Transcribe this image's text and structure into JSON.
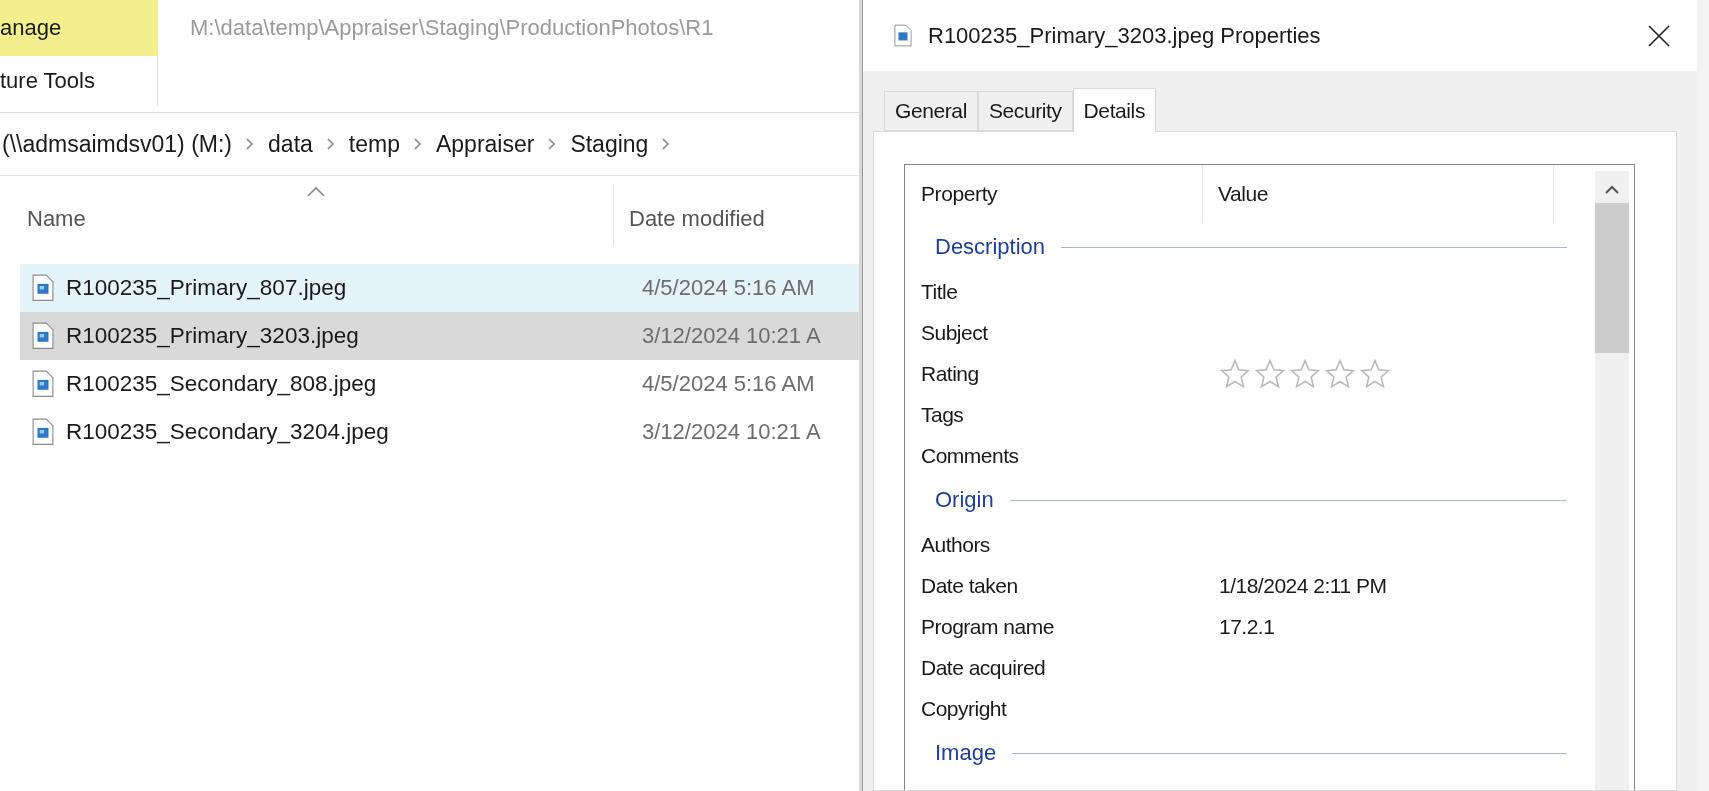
{
  "ribbon": {
    "tabs": [
      {
        "label": "anage",
        "selected": true
      }
    ],
    "context_label": "ture Tools"
  },
  "title_path": "M:\\data\\temp\\Appraiser\\Staging\\ProductionPhotos\\R1",
  "breadcrumb": [
    "(\\\\admsaimdsv01) (M:)",
    "data",
    "temp",
    "Appraiser",
    "Staging"
  ],
  "columns": [
    {
      "label": "Name",
      "sorted": true
    },
    {
      "label": "Date modified",
      "sorted": false
    }
  ],
  "files": [
    {
      "name": "R100235_Primary_807.jpeg",
      "date": "4/5/2024 5:16 AM",
      "selected": false,
      "hovered": true
    },
    {
      "name": "R100235_Primary_3203.jpeg",
      "date": "3/12/2024 10:21 A",
      "selected": true,
      "hovered": false
    },
    {
      "name": "R100235_Secondary_808.jpeg",
      "date": "4/5/2024 5:16 AM",
      "selected": false,
      "hovered": false
    },
    {
      "name": "R100235_Secondary_3204.jpeg",
      "date": "3/12/2024 10:21 A",
      "selected": false,
      "hovered": false
    }
  ],
  "dialog": {
    "title": "R100235_Primary_3203.jpeg Properties",
    "tabs": [
      {
        "label": "General",
        "selected": false
      },
      {
        "label": "Security",
        "selected": false
      },
      {
        "label": "Details",
        "selected": true
      }
    ],
    "list_columns": [
      "Property",
      "Value"
    ],
    "groups": [
      {
        "name": "Description",
        "rows": [
          {
            "property": "Title",
            "kind": "text"
          },
          {
            "property": "Subject",
            "kind": "text"
          },
          {
            "property": "Rating",
            "kind": "stars",
            "stars": 0
          },
          {
            "property": "Tags",
            "kind": "text"
          },
          {
            "property": "Comments",
            "kind": "text"
          }
        ]
      },
      {
        "name": "Origin",
        "rows": [
          {
            "property": "Authors",
            "kind": "text"
          },
          {
            "property": "Date taken",
            "kind": "text",
            "value": "1/18/2024 2:11 PM"
          },
          {
            "property": "Program name",
            "kind": "text",
            "value": "17.2.1"
          },
          {
            "property": "Date acquired",
            "kind": "text"
          },
          {
            "property": "Copyright",
            "kind": "text"
          }
        ]
      },
      {
        "name": "Image"
      }
    ]
  }
}
